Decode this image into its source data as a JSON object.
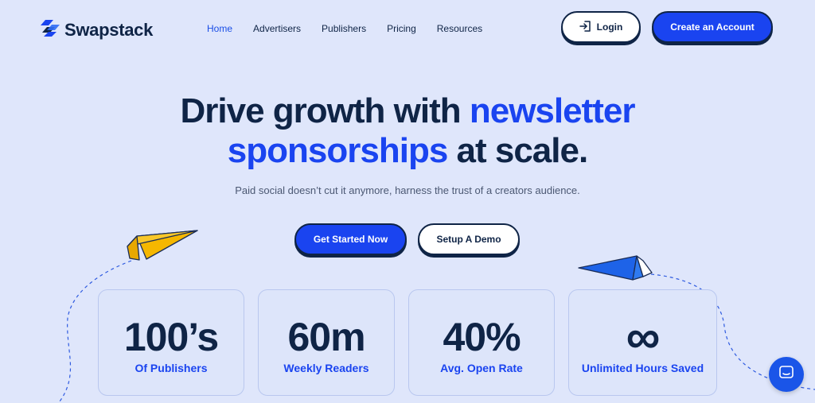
{
  "brand": {
    "name": "Swapstack"
  },
  "nav": {
    "items": [
      {
        "label": "Home",
        "active": true
      },
      {
        "label": "Advertisers"
      },
      {
        "label": "Publishers"
      },
      {
        "label": "Pricing"
      },
      {
        "label": "Resources"
      }
    ]
  },
  "header": {
    "login_label": "Login",
    "create_account_label": "Create an Account"
  },
  "hero": {
    "title_part1": "Drive growth with ",
    "title_highlight1": "newsletter",
    "title_highlight2": "sponsorships",
    "title_part2": " at scale.",
    "subtitle": "Paid social doesn’t cut it anymore, harness the trust of a creators audience.",
    "cta_primary": "Get Started Now",
    "cta_secondary": "Setup A Demo"
  },
  "stats": [
    {
      "value": "100’s",
      "label": "Of Publishers"
    },
    {
      "value": "60m",
      "label": "Weekly Readers"
    },
    {
      "value": "40%",
      "label": "Avg. Open Rate"
    },
    {
      "value": "∞",
      "label": "Unlimited Hours Saved"
    }
  ],
  "colors": {
    "background": "#dfe6fb",
    "accent": "#1a44f0",
    "text_dark": "#0f2446",
    "plane_yellow": "#f5b700",
    "plane_blue": "#1e63e8"
  },
  "icons": {
    "logo": "swapstack-logo-icon",
    "login": "login-icon",
    "chat": "chat-icon"
  }
}
